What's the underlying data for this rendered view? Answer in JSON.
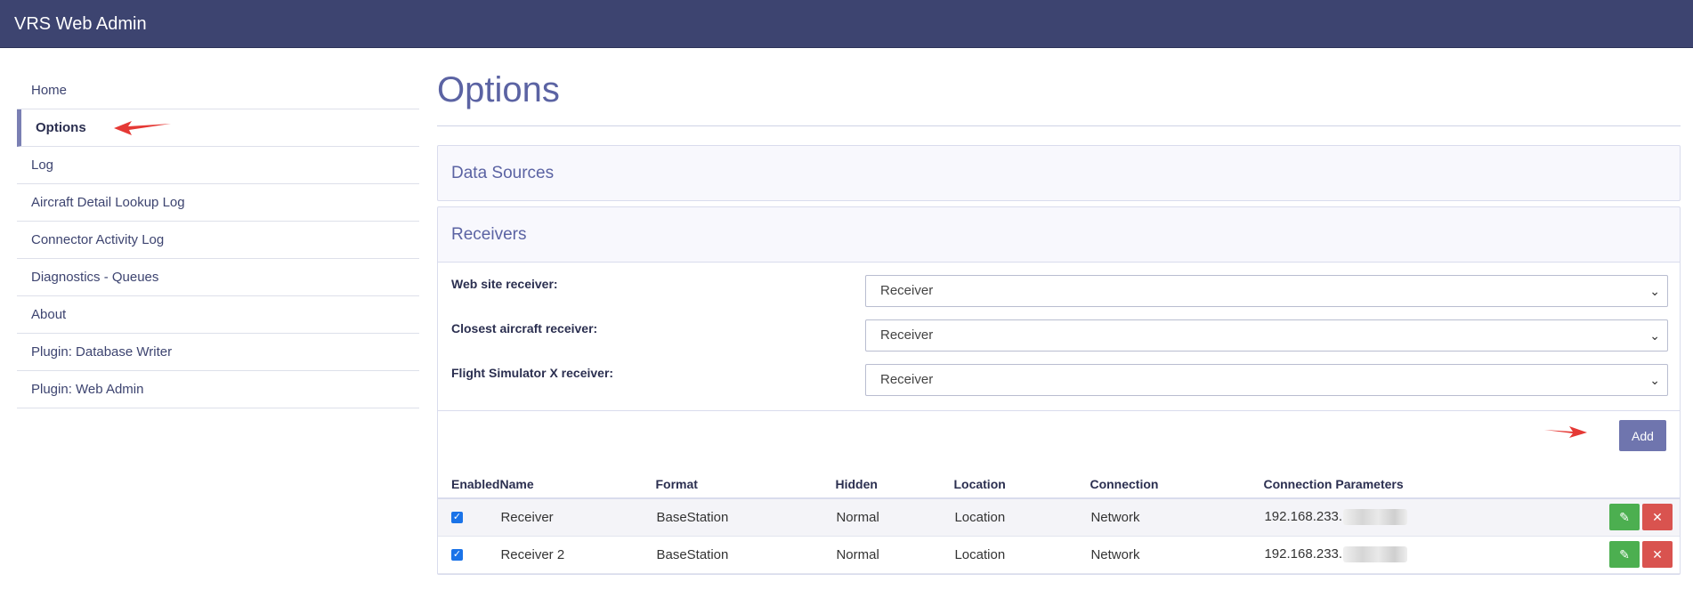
{
  "app": {
    "title": "VRS Web Admin"
  },
  "sidebar": {
    "items": [
      {
        "label": "Home"
      },
      {
        "label": "Options"
      },
      {
        "label": "Log"
      },
      {
        "label": "Aircraft Detail Lookup Log"
      },
      {
        "label": "Connector Activity Log"
      },
      {
        "label": "Diagnostics - Queues"
      },
      {
        "label": "About"
      },
      {
        "label": "Plugin: Database Writer"
      },
      {
        "label": "Plugin: Web Admin"
      }
    ],
    "active_index": 1
  },
  "main": {
    "title": "Options",
    "data_sources_heading": "Data Sources",
    "receivers_heading": "Receivers",
    "form": {
      "web_site_receiver_label": "Web site receiver:",
      "web_site_receiver_value": "Receiver",
      "closest_aircraft_receiver_label": "Closest aircraft receiver:",
      "closest_aircraft_receiver_value": "Receiver",
      "fsx_receiver_label": "Flight Simulator X receiver:",
      "fsx_receiver_value": "Receiver"
    },
    "add_label": "Add",
    "table": {
      "headers": {
        "enabled": "Enabled",
        "name": "Name",
        "format": "Format",
        "hidden": "Hidden",
        "location": "Location",
        "connection": "Connection",
        "connection_parameters": "Connection Parameters"
      },
      "rows": [
        {
          "enabled": true,
          "name": "Receiver",
          "format": "BaseStation",
          "hidden": "Normal",
          "location": "Location",
          "connection": "Network",
          "params": "192.168.233."
        },
        {
          "enabled": true,
          "name": "Receiver 2",
          "format": "BaseStation",
          "hidden": "Normal",
          "location": "Location",
          "connection": "Network",
          "params": "192.168.233."
        }
      ]
    }
  },
  "colors": {
    "topbar": "#3d4470",
    "accent": "#5b63a3",
    "annotation_arrow": "#e53935"
  },
  "icons": {
    "edit": "pencil-icon",
    "delete": "close-icon",
    "select": "chevron-down-icon"
  }
}
